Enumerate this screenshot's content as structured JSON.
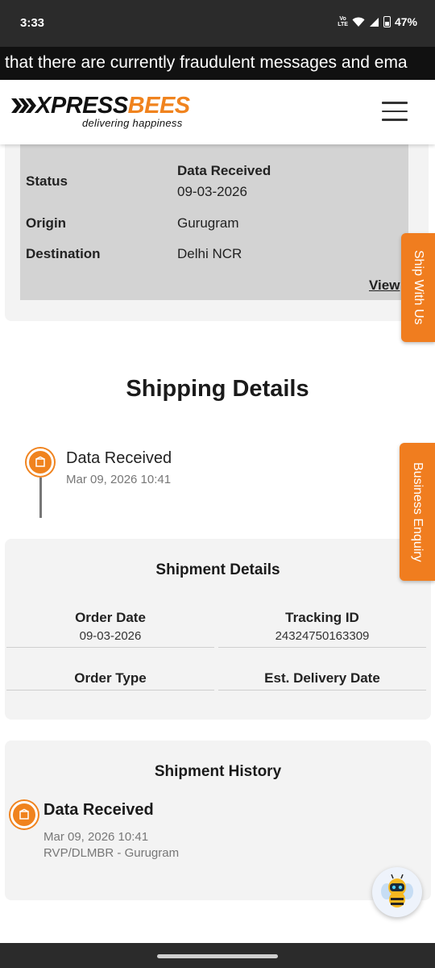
{
  "status_bar": {
    "time": "3:33",
    "network_label": "Vo\nLTE",
    "battery_percent": "47%"
  },
  "marquee": {
    "text": "that there are currently fraudulent messages and ema"
  },
  "header": {
    "logo_brand_a": "XPRESS",
    "logo_brand_b": "BEES",
    "logo_tagline": "delivering happiness",
    "menu_icon": "hamburger-icon"
  },
  "summary": {
    "rows": [
      {
        "label": "Status",
        "value_line1": "Data Received",
        "value_line2": "09-03-2026"
      },
      {
        "label": "Origin",
        "value": "Gurugram"
      },
      {
        "label": "Destination",
        "value": "Delhi NCR"
      }
    ],
    "view_link": "View"
  },
  "side_tabs": {
    "ship": "Ship With Us",
    "business": "Business Enquiry"
  },
  "shipping_details": {
    "title": "Shipping Details",
    "timeline": [
      {
        "title": "Data Received",
        "date": "Mar 09, 2026 10:41",
        "icon": "package-icon"
      }
    ]
  },
  "shipment_details": {
    "title": "Shipment Details",
    "fields": [
      {
        "label": "Order Date",
        "value": "09-03-2026"
      },
      {
        "label": "Tracking ID",
        "value": "24324750163309"
      },
      {
        "label": "Order Type",
        "value": ""
      },
      {
        "label": "Est. Delivery Date",
        "value": ""
      }
    ]
  },
  "shipment_history": {
    "title": "Shipment History",
    "entries": [
      {
        "status": "Data Received",
        "date": "Mar 09, 2026 10:41",
        "location": "RVP/DLMBR - Gurugram",
        "icon": "package-icon"
      }
    ]
  },
  "colors": {
    "brand_orange": "#f0831e",
    "summary_grey": "#d3d3d3",
    "card_bg": "#f3f3f3"
  }
}
